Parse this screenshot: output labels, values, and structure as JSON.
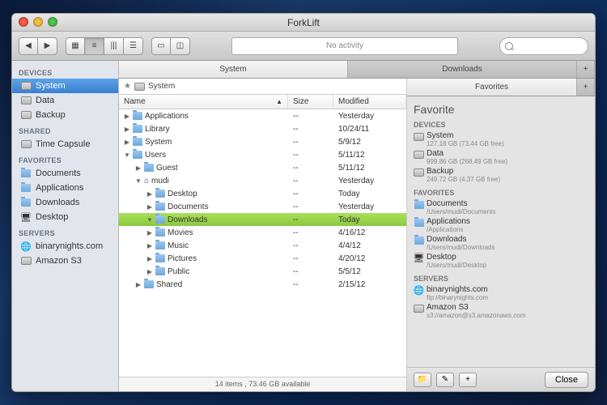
{
  "window": {
    "title": "ForkLift"
  },
  "toolbar": {
    "activity": "No activity",
    "search_placeholder": ""
  },
  "sidebar": {
    "groups": [
      {
        "label": "DEVICES",
        "items": [
          {
            "label": "System",
            "icon": "drive",
            "selected": true
          },
          {
            "label": "Data",
            "icon": "drive"
          },
          {
            "label": "Backup",
            "icon": "drive"
          }
        ]
      },
      {
        "label": "SHARED",
        "items": [
          {
            "label": "Time Capsule",
            "icon": "drive"
          }
        ]
      },
      {
        "label": "FAVORITES",
        "items": [
          {
            "label": "Documents",
            "icon": "folder"
          },
          {
            "label": "Applications",
            "icon": "folder"
          },
          {
            "label": "Downloads",
            "icon": "folder"
          },
          {
            "label": "Desktop",
            "icon": "monitor"
          }
        ]
      },
      {
        "label": "SERVERS",
        "items": [
          {
            "label": "binarynights.com",
            "icon": "globe"
          },
          {
            "label": "Amazon S3",
            "icon": "drive"
          }
        ]
      }
    ]
  },
  "tabs_left": [
    {
      "label": "System",
      "active": true
    },
    {
      "label": "Downloads",
      "active": false
    }
  ],
  "path": {
    "star": "★",
    "drive": "System"
  },
  "columns": {
    "name": "Name",
    "size": "Size",
    "modified": "Modified"
  },
  "rows": [
    {
      "indent": 0,
      "disc": "▶",
      "icon": "folder",
      "name": "Applications",
      "size": "--",
      "mod": "Yesterday"
    },
    {
      "indent": 0,
      "disc": "▶",
      "icon": "folder",
      "name": "Library",
      "size": "--",
      "mod": "10/24/11"
    },
    {
      "indent": 0,
      "disc": "▶",
      "icon": "folder",
      "name": "System",
      "size": "--",
      "mod": "5/9/12"
    },
    {
      "indent": 0,
      "disc": "▼",
      "icon": "folder",
      "name": "Users",
      "size": "--",
      "mod": "5/11/12"
    },
    {
      "indent": 1,
      "disc": "▶",
      "icon": "folder",
      "name": "Guest",
      "size": "--",
      "mod": "5/11/12"
    },
    {
      "indent": 1,
      "disc": "▼",
      "icon": "home",
      "name": "mudi",
      "size": "--",
      "mod": "Yesterday"
    },
    {
      "indent": 2,
      "disc": "▶",
      "icon": "folder",
      "name": "Desktop",
      "size": "--",
      "mod": "Today"
    },
    {
      "indent": 2,
      "disc": "▶",
      "icon": "folder",
      "name": "Documents",
      "size": "--",
      "mod": "Yesterday"
    },
    {
      "indent": 2,
      "disc": "▼",
      "icon": "folder",
      "name": "Downloads",
      "size": "--",
      "mod": "Today",
      "selected": true
    },
    {
      "indent": 2,
      "disc": "▶",
      "icon": "folder",
      "name": "Movies",
      "size": "--",
      "mod": "4/16/12"
    },
    {
      "indent": 2,
      "disc": "▶",
      "icon": "folder",
      "name": "Music",
      "size": "--",
      "mod": "4/4/12"
    },
    {
      "indent": 2,
      "disc": "▶",
      "icon": "folder",
      "name": "Pictures",
      "size": "--",
      "mod": "4/20/12"
    },
    {
      "indent": 2,
      "disc": "▶",
      "icon": "folder",
      "name": "Public",
      "size": "--",
      "mod": "5/5/12"
    },
    {
      "indent": 1,
      "disc": "▶",
      "icon": "folder",
      "name": "Shared",
      "size": "--",
      "mod": "2/15/12"
    }
  ],
  "status": "14 items , 73.46 GB available",
  "tabs_right": [
    {
      "label": "Favorites",
      "active": true
    }
  ],
  "panel": {
    "title": "Favorite",
    "groups": [
      {
        "label": "DEVICES",
        "items": [
          {
            "icon": "drive",
            "name": "System",
            "sub": "127.18 GB (73.44 GB free)"
          },
          {
            "icon": "drive",
            "name": "Data",
            "sub": "999.86 GB (268.49 GB free)"
          },
          {
            "icon": "drive",
            "name": "Backup",
            "sub": "249.72 GB (4.37 GB free)"
          }
        ]
      },
      {
        "label": "FAVORITES",
        "items": [
          {
            "icon": "folder",
            "name": "Documents",
            "sub": "/Users/mudi/Documents"
          },
          {
            "icon": "folder",
            "name": "Applications",
            "sub": "/Applications"
          },
          {
            "icon": "folder",
            "name": "Downloads",
            "sub": "/Users/mudi/Downloads"
          },
          {
            "icon": "monitor",
            "name": "Desktop",
            "sub": "/Users/mudi/Desktop"
          }
        ]
      },
      {
        "label": "SERVERS",
        "items": [
          {
            "icon": "globe",
            "name": "binarynights.com",
            "sub": "ftp://binarynights.com"
          },
          {
            "icon": "drive",
            "name": "Amazon S3",
            "sub": "s3://amazon@s3.amazonaws.com"
          }
        ]
      }
    ],
    "footer": {
      "new": "📁",
      "edit": "✎",
      "add": "+",
      "close": "Close"
    }
  }
}
